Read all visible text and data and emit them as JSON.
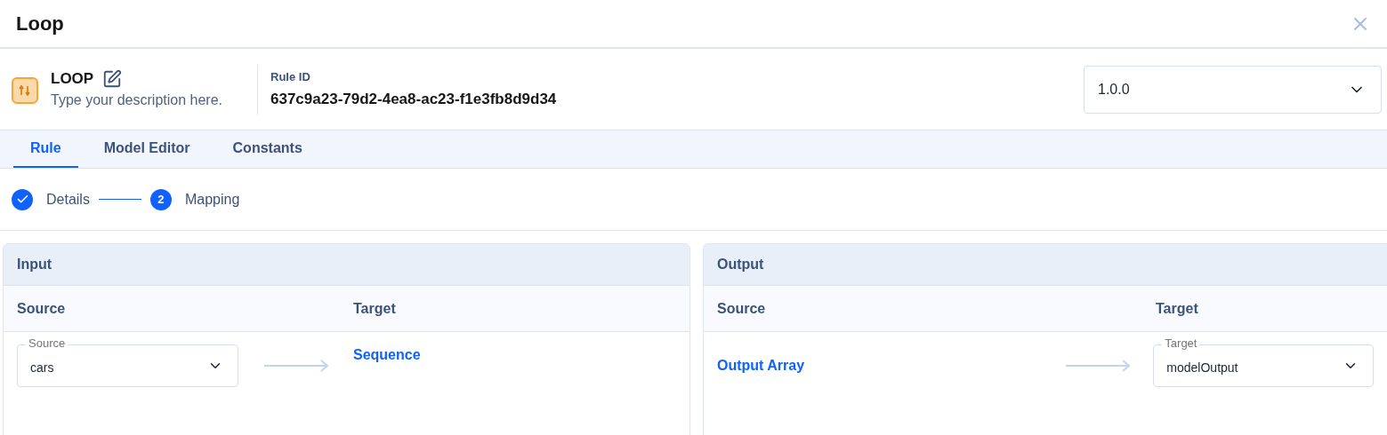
{
  "window": {
    "title": "Loop"
  },
  "rule": {
    "name": "LOOP",
    "description": "Type your description here.",
    "id_label": "Rule ID",
    "id": "637c9a23-79d2-4ea8-ac23-f1e3fb8d9d34",
    "version": "1.0.0"
  },
  "tabs": [
    {
      "label": "Rule",
      "selected": true
    },
    {
      "label": "Model Editor",
      "selected": false
    },
    {
      "label": "Constants",
      "selected": false
    }
  ],
  "steps": [
    {
      "label": "Details",
      "completed": true
    },
    {
      "label": "Mapping",
      "completed": false,
      "number": "2"
    }
  ],
  "panels": [
    {
      "title": "Input",
      "columns": [
        "Source",
        "Target"
      ],
      "row": [
        {
          "kind": "select",
          "label": "Source",
          "value": "cars"
        },
        {
          "kind": "link",
          "text": "Sequence"
        }
      ]
    },
    {
      "title": "Output",
      "columns": [
        "Source",
        "Target"
      ],
      "row": [
        {
          "kind": "link",
          "text": "Output Array"
        },
        {
          "kind": "select",
          "label": "Target",
          "value": "modelOutput"
        }
      ]
    }
  ]
}
